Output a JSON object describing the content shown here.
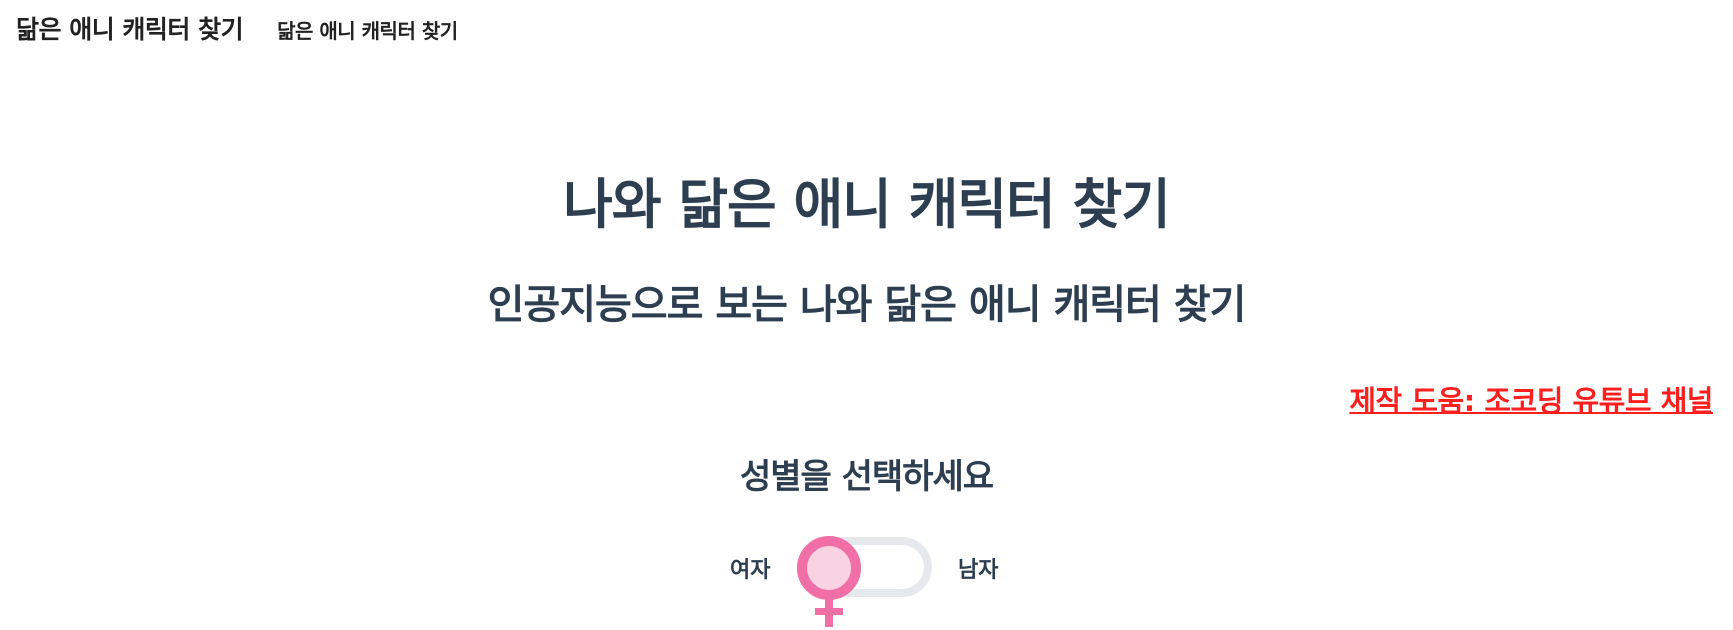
{
  "header": {
    "brand": "닮은 애니 캐릭터 찾기",
    "brand_sub": "닮은 애니 캐릭터 찾기"
  },
  "main": {
    "title": "나와 닮은 애니 캐릭터 찾기",
    "subtitle": "인공지능으로 보는 나와 닮은 애니 캐릭터 찾기",
    "credit_link": "제작 도움: 조코딩 유튜브 채널",
    "gender_prompt": "성별을 선택하세요"
  },
  "gender_toggle": {
    "female_label": "여자",
    "male_label": "남자",
    "selected": "female",
    "knob_icon": "female-symbol-icon"
  },
  "colors": {
    "text": "#2c3e50",
    "credit_link": "#ff1f1f",
    "female_pink": "#f06fa6",
    "female_pink_light": "#f9d3e2",
    "track": "#e5e8ec"
  }
}
